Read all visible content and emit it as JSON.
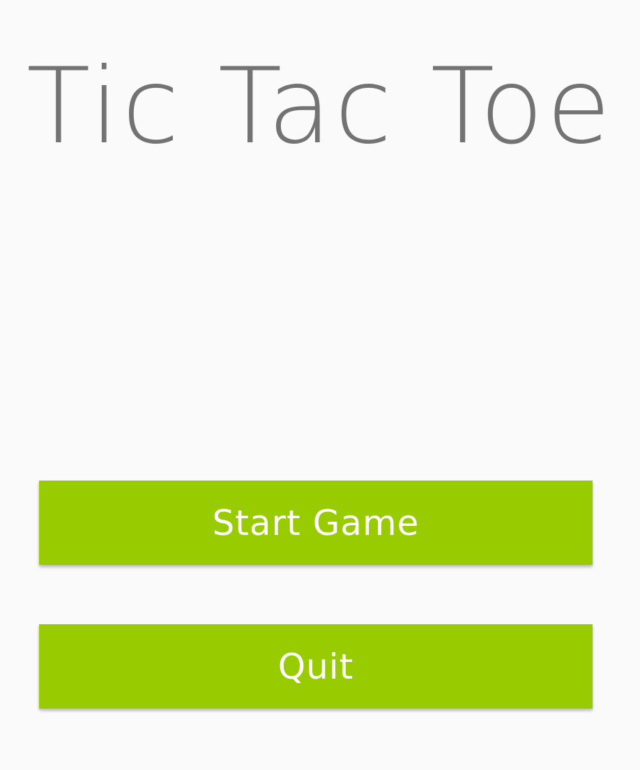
{
  "app": {
    "title": "Tic Tac Toe"
  },
  "menu": {
    "start_label": "Start Game",
    "quit_label": "Quit"
  },
  "colors": {
    "background": "#fafafa",
    "title_text": "#737373",
    "button_background": "#99cc00",
    "button_text": "#ffffff"
  }
}
